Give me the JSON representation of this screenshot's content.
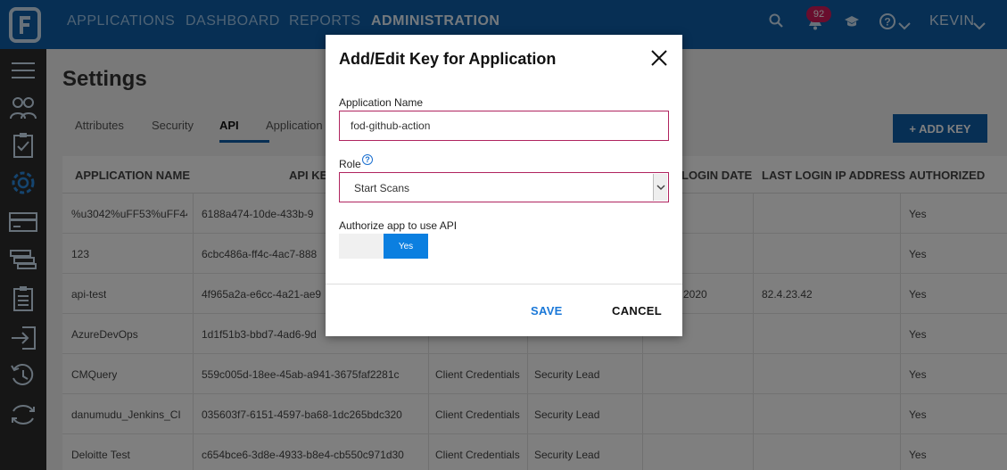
{
  "nav": {
    "items": [
      "APPLICATIONS",
      "DASHBOARD",
      "REPORTS",
      "ADMINISTRATION"
    ],
    "active": "ADMINISTRATION",
    "notifications_count": "92",
    "user": "KEVIN",
    "icons": [
      "search-icon",
      "bell-icon",
      "graduation-cap-icon",
      "help-icon",
      "chevron-down-icon"
    ]
  },
  "sidebar": {
    "icons": [
      "menu-icon",
      "users-icon",
      "clipboard-check-icon",
      "gear-icon",
      "card-icon",
      "layers-icon",
      "clipboard-list-icon",
      "sign-in-icon",
      "history-icon",
      "sync-icon"
    ]
  },
  "page": {
    "title": "Settings",
    "tabs": [
      "Attributes",
      "Security",
      "API",
      "Application"
    ],
    "active_tab": "API",
    "add_key_label": "+ ADD KEY"
  },
  "table": {
    "headers": [
      "APPLICATION NAME",
      "API KE",
      "LOGIN DATE",
      "LAST LOGIN IP ADDRESS",
      "AUTHORIZED"
    ],
    "rows": [
      {
        "name": "%u3042%uFF53%uFF44",
        "key": "6188a474-10de-433b-9",
        "grant": "",
        "role": "",
        "login": "",
        "ip": "",
        "auth": "Yes"
      },
      {
        "name": "123",
        "key": "6cbc486a-ff4c-4ac7-888",
        "grant": "",
        "role": "",
        "login": "",
        "ip": "",
        "auth": "Yes"
      },
      {
        "name": "api-test",
        "key": "4f965a2a-e6cc-4a21-ae9",
        "grant": "",
        "role": "",
        "login": "2020",
        "ip": "82.4.23.42",
        "auth": "Yes"
      },
      {
        "name": "AzureDevOps",
        "key": "1d1f51b3-bbd7-4ad6-9d",
        "grant": "",
        "role": "",
        "login": "",
        "ip": "",
        "auth": "Yes"
      },
      {
        "name": "CMQuery",
        "key": "559c005d-18ee-45ab-a941-3675faf2281c",
        "grant": "Client Credentials",
        "role": "Security Lead",
        "login": "",
        "ip": "",
        "auth": "Yes"
      },
      {
        "name": "danumudu_Jenkins_CI",
        "key": "035603f7-6151-4597-ba68-1dc265bdc320",
        "grant": "Client Credentials",
        "role": "Security Lead",
        "login": "",
        "ip": "",
        "auth": "Yes"
      },
      {
        "name": "Deloitte Test",
        "key": "c654bce6-3d8e-4933-b8e4-cb550c971d30",
        "grant": "Client Credentials",
        "role": "Security Lead",
        "login": "",
        "ip": "",
        "auth": "Yes"
      }
    ]
  },
  "modal": {
    "title": "Add/Edit Key for Application",
    "app_name_label": "Application Name",
    "app_name_value": "fod-github-action",
    "role_label": "Role",
    "role_value": "Start Scans",
    "authorize_label": "Authorize app to use API",
    "toggle_label": "Yes",
    "save_label": "SAVE",
    "cancel_label": "CANCEL"
  }
}
